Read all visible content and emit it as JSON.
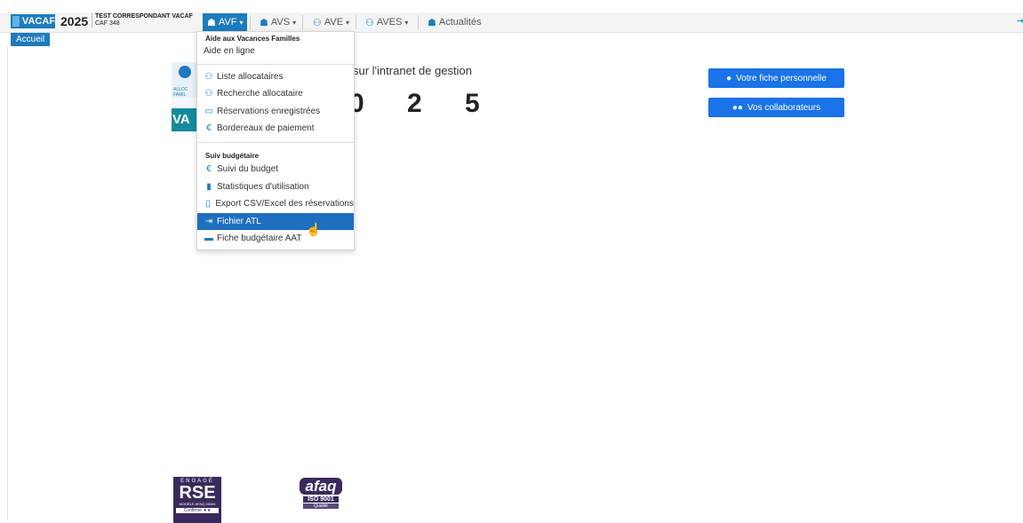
{
  "brand": {
    "logo_text": "VACAF",
    "year": "2025",
    "user_name": "TEST CORRESPONDANT VACAF",
    "user_org": "CAF 348"
  },
  "nav": {
    "items": [
      {
        "label": "AVF",
        "icon": "family-icon",
        "active": true
      },
      {
        "label": "AVS",
        "icon": "family-icon"
      },
      {
        "label": "AVE",
        "icon": "people-icon"
      },
      {
        "label": "AVES",
        "icon": "people-icon"
      },
      {
        "label": "Actualités",
        "icon": "family-icon"
      }
    ],
    "right_icon": "logout-icon"
  },
  "tab": {
    "label": "Accueil"
  },
  "dropdown": {
    "header1": "Aide aux Vacances Familles",
    "help": "Aide en ligne",
    "items1": [
      {
        "label": "Liste allocataires",
        "icon": "people-icon"
      },
      {
        "label": "Recherche allocataire",
        "icon": "people-icon"
      },
      {
        "label": "Réservations enregistrées",
        "icon": "calendar-icon"
      },
      {
        "label": "Bordereaux de paiement",
        "icon": "euro-icon"
      }
    ],
    "header2": "Suiv budgétaire",
    "items2": [
      {
        "label": "Suivi du budget",
        "icon": "euro-icon"
      },
      {
        "label": "Statistiques d'utilisation",
        "icon": "bar-chart-icon"
      },
      {
        "label": "Export CSV/Excel des réservations",
        "icon": "file-csv-icon"
      },
      {
        "label": "Fichier ATL",
        "icon": "file-export-icon",
        "selected": true
      },
      {
        "label": "Fiche budgétaire AAT",
        "icon": "bus-icon"
      }
    ]
  },
  "content": {
    "welcome": "sur l'intranet de gestion",
    "big_year": "0 2 5",
    "logo_caption": "ALLOC FAMIL",
    "logo_vac": "VA",
    "btn_personal": "Votre fiche personnelle",
    "btn_collab": "Vos collaborateurs"
  },
  "badges": {
    "rse": {
      "top": "ENGAGÉ",
      "main": "RSE",
      "sub": "MODÈLE AFAQ 26000",
      "confirm": "Confirmé ★★"
    },
    "afaq": {
      "main": "afaq",
      "iso": "ISO 9001",
      "qual": "Qualité"
    }
  },
  "colors": {
    "accent": "#1e7bbd",
    "button": "#1a73e8",
    "selected": "#1e6fc0"
  }
}
